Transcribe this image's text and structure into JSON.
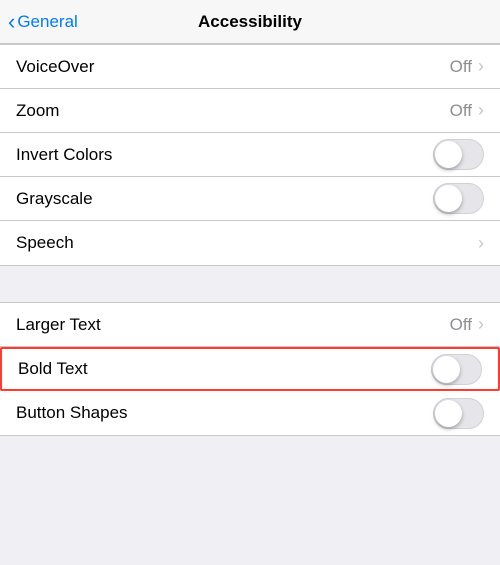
{
  "nav": {
    "back_label": "General",
    "title": "Accessibility"
  },
  "groups": [
    {
      "id": "group1",
      "rows": [
        {
          "id": "voiceover",
          "label": "VoiceOver",
          "value": "Off",
          "has_chevron": true,
          "has_toggle": false
        },
        {
          "id": "zoom",
          "label": "Zoom",
          "value": "Off",
          "has_chevron": true,
          "has_toggle": false
        },
        {
          "id": "invert-colors",
          "label": "Invert Colors",
          "value": "",
          "has_chevron": false,
          "has_toggle": true,
          "toggle_on": false
        },
        {
          "id": "grayscale",
          "label": "Grayscale",
          "value": "",
          "has_chevron": false,
          "has_toggle": true,
          "toggle_on": false
        },
        {
          "id": "speech",
          "label": "Speech",
          "value": "",
          "has_chevron": true,
          "has_toggle": false
        }
      ]
    },
    {
      "id": "group2",
      "rows": [
        {
          "id": "larger-text",
          "label": "Larger Text",
          "value": "Off",
          "has_chevron": true,
          "has_toggle": false
        },
        {
          "id": "bold-text",
          "label": "Bold Text",
          "value": "",
          "has_chevron": false,
          "has_toggle": true,
          "toggle_on": false,
          "highlighted": true
        },
        {
          "id": "button-shapes",
          "label": "Button Shapes",
          "value": "",
          "has_chevron": false,
          "has_toggle": true,
          "toggle_on": false
        }
      ]
    }
  ]
}
